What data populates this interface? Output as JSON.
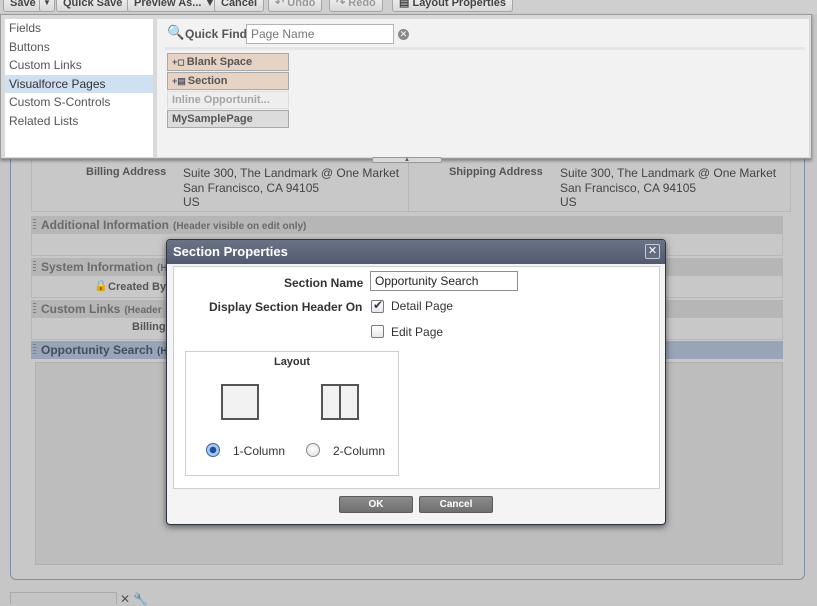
{
  "toolbar": {
    "save": "Save",
    "save_menu": "▼",
    "quick_save": "Quick Save",
    "preview_as": "Preview As... ▼",
    "cancel": "Cancel",
    "undo": "Undo",
    "redo": "Redo",
    "layout_properties": "Layout Properties"
  },
  "palette": {
    "categories": [
      "Fields",
      "Buttons",
      "Custom Links",
      "Visualforce Pages",
      "Custom S-Controls",
      "Related Lists"
    ],
    "selected_category": "Visualforce Pages",
    "quick_find": {
      "label": "Quick Find",
      "placeholder": "Page Name"
    },
    "items": [
      "Blank Space",
      "Section",
      "Inline Opportunit...",
      "MySamplePage"
    ]
  },
  "layout": {
    "billing_address_label": "Billing Address",
    "billing_address": [
      "Suite 300, The Landmark @ One Market",
      "San Francisco, CA 94105",
      "US"
    ],
    "shipping_address_label": "Shipping Address",
    "shipping_address": [
      "Suite 300, The Landmark @ One Market",
      "San Francisco, CA 94105",
      "US"
    ],
    "sections": [
      {
        "title": "Additional Information",
        "note": "(Header visible on edit only)"
      },
      {
        "title": "System Information",
        "note": "(H"
      },
      {
        "title": "Custom Links",
        "note": "(Header"
      },
      {
        "title": "Opportunity Search",
        "note": "(H"
      }
    ],
    "created_by": "Created By",
    "billing_partial": "Billing"
  },
  "dialog": {
    "title": "Section Properties",
    "section_name_label": "Section Name",
    "section_name_value": "Opportunity Search",
    "display_header_label": "Display Section Header On",
    "detail_page_label": "Detail Page",
    "detail_page_checked": true,
    "edit_page_label": "Edit Page",
    "edit_page_checked": false,
    "layout_title": "Layout",
    "one_column_label": "1-Column",
    "two_column_label": "2-Column",
    "selected_layout": "1-Column",
    "ok_label": "OK",
    "cancel_label": "Cancel"
  }
}
